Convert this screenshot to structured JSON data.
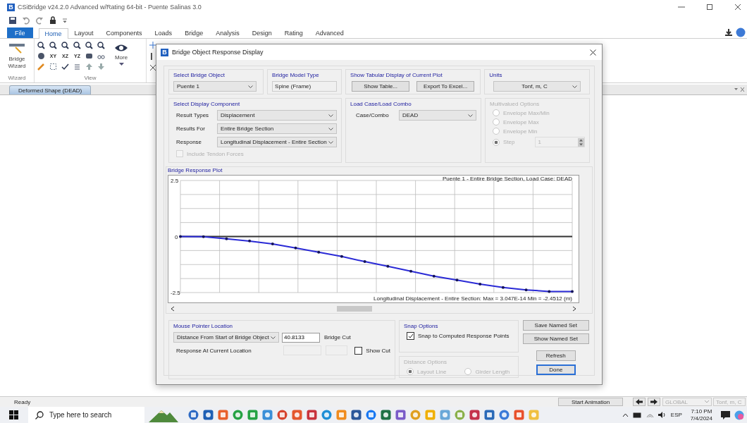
{
  "window": {
    "logo": "B",
    "title": "CSiBridge v24.2.0 Advanced w/Rating 64-bit - Puente Salinas 3.0"
  },
  "ribbon_tabs": [
    {
      "label": "File",
      "kind": "file",
      "selected": false
    },
    {
      "label": "Home",
      "kind": "tab",
      "selected": true
    },
    {
      "label": "Layout",
      "kind": "tab",
      "selected": false
    },
    {
      "label": "Components",
      "kind": "tab",
      "selected": false
    },
    {
      "label": "Loads",
      "kind": "tab",
      "selected": false
    },
    {
      "label": "Bridge",
      "kind": "tab",
      "selected": false
    },
    {
      "label": "Analysis",
      "kind": "tab",
      "selected": false
    },
    {
      "label": "Design",
      "kind": "tab",
      "selected": false
    },
    {
      "label": "Rating",
      "kind": "tab",
      "selected": false
    },
    {
      "label": "Advanced",
      "kind": "tab",
      "selected": false
    }
  ],
  "ribbon": {
    "wizard_button": "Bridge Wizard",
    "wizard_group": "Wizard",
    "view_planes": [
      "XY",
      "XZ",
      "YZ"
    ],
    "more_button": "More",
    "view_group": "View"
  },
  "document_tab": {
    "label": "Deformed Shape (DEAD)",
    "selected": true
  },
  "dialog": {
    "logo": "B",
    "title": "Bridge Object Response Display",
    "bridge_object": {
      "label": "Select Bridge Object",
      "value": "Puente 1"
    },
    "model_type": {
      "label": "Bridge Model Type",
      "value": "Spine (Frame)"
    },
    "tabular": {
      "label": "Show Tabular Display of Current Plot",
      "buttons": [
        "Show Table...",
        "Export To Excel..."
      ]
    },
    "units": {
      "label": "Units",
      "value": "Tonf, m, C"
    },
    "display_component": {
      "label": "Select Display Component",
      "fields": [
        {
          "label": "Result Types",
          "value": "Displacement"
        },
        {
          "label": "Results For",
          "value": "Entire Bridge Section"
        },
        {
          "label": "Response",
          "value": "Longitudinal Displacement - Entire Section"
        }
      ],
      "include_tendon": {
        "label": "Include Tendon Forces",
        "checked": false,
        "disabled": true
      }
    },
    "load_case": {
      "label": "Load Case/Load Combo",
      "field_label": "Case/Combo",
      "value": "DEAD"
    },
    "multivalued": {
      "label": "Multivalued Options",
      "disabled": true,
      "options": [
        {
          "label": "Envelope Max/Min",
          "selected": false
        },
        {
          "label": "Envelope Max",
          "selected": false
        },
        {
          "label": "Envelope Min",
          "selected": false
        },
        {
          "label": "Step",
          "selected": true
        }
      ],
      "step_value": "1"
    },
    "plot": {
      "label": "Bridge Response Plot",
      "chart_data": {
        "type": "line",
        "title": "Puente 1 - Entire Bridge Section,  Load Case: DEAD",
        "xlabel": "Longitudinal Displacement - Entire Section:  Max = 3.047E-14   Min = -2.4512  (m)",
        "ylim": [
          -2.5,
          2.5
        ],
        "yticks": [
          -2.5,
          0,
          2.5
        ],
        "series": [
          {
            "color": "#2a2ad6",
            "values": [
              0,
              -0.01,
              -0.1,
              -0.2,
              -0.33,
              -0.51,
              -0.7,
              -0.89,
              -1.12,
              -1.33,
              -1.55,
              -1.77,
              -1.94,
              -2.12,
              -2.27,
              -2.38,
              -2.45,
              -2.45
            ]
          }
        ]
      }
    },
    "mouse_pointer": {
      "label": "Mouse Pointer Location",
      "measure": "Distance From Start of Bridge Object",
      "distance": "40.8133",
      "cut_label": "Bridge Cut",
      "response_label": "Response At Current Location",
      "show_cut": {
        "label": "Show Cut",
        "checked": false
      }
    },
    "snap": {
      "label": "Snap Options",
      "option": {
        "label": "Snap to Computed Response Points",
        "checked": true
      }
    },
    "distance_options": {
      "label": "Distance Options",
      "disabled": true,
      "options": [
        {
          "label": "Layout Line",
          "selected": true
        },
        {
          "label": "Girder Length",
          "selected": false
        }
      ]
    },
    "buttons": [
      {
        "label": "Save Named Set",
        "kind": "wide",
        "default": false
      },
      {
        "label": "Show Named Set",
        "kind": "wide",
        "default": false
      },
      {
        "label": "Refresh",
        "kind": "narrow",
        "default": false
      },
      {
        "label": "Done",
        "kind": "narrow",
        "default": true
      }
    ]
  },
  "status_bar": {
    "text": "Ready",
    "animation_button": "Start Animation",
    "coord_system": "GLOBAL",
    "units": "Tonf, m, C"
  },
  "taskbar": {
    "search_placeholder": "Type here to search",
    "language": "ESP",
    "time": "7:10 PM",
    "date": "7/4/2024"
  }
}
